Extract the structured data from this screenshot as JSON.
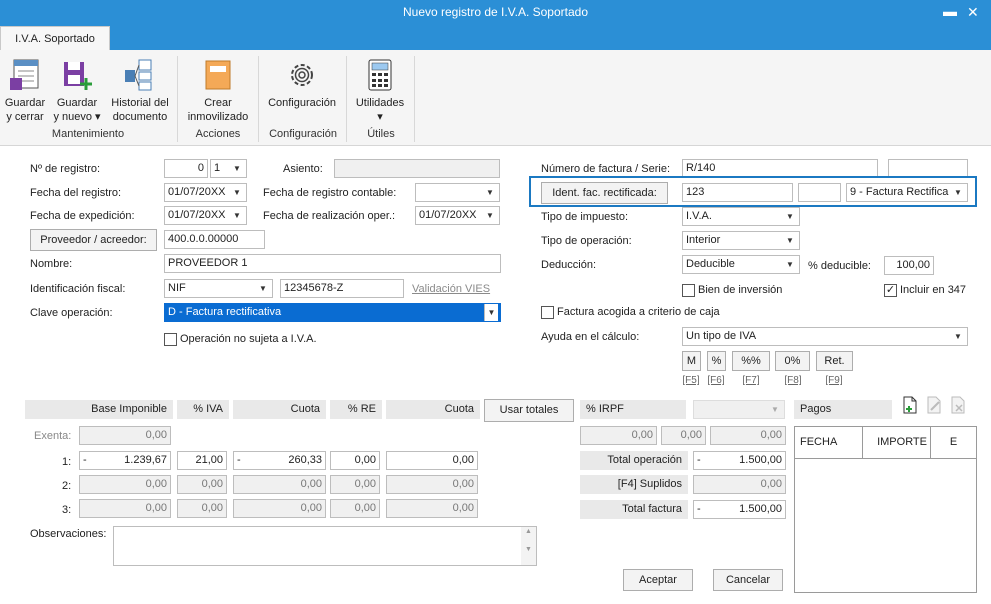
{
  "window": {
    "title": "Nuevo registro de I.V.A. Soportado",
    "minimize": "▬",
    "close": "✕"
  },
  "tab": {
    "label": "I.V.A. Soportado"
  },
  "ribbon": {
    "guardar_cerrar": "Guardar\ny cerrar",
    "guardar_nuevo": "Guardar\ny nuevo ▾",
    "historial": "Historial del\ndocumento",
    "crear": "Crear\ninmovilizado",
    "configuracion": "Configuración",
    "utilidades": "Utilidades\n▾",
    "groups": {
      "mantenimiento": "Mantenimiento",
      "acciones": "Acciones",
      "configuracion": "Configuración",
      "utiles": "Útiles"
    }
  },
  "form": {
    "num_registro_label": "Nº de registro:",
    "num_registro_value": "0",
    "num_registro_serie": "1",
    "asiento_label": "Asiento:",
    "fecha_registro_label": "Fecha del registro:",
    "fecha_registro_value": "01/07/20XX",
    "fecha_contable_label": "Fecha de registro contable:",
    "fecha_expedicion_label": "Fecha de expedición:",
    "fecha_expedicion_value": "01/07/20XX",
    "fecha_realizacion_label": "Fecha de realización oper.:",
    "fecha_realizacion_value": "01/07/20XX",
    "proveedor_button": "Proveedor / acreedor:",
    "proveedor_value": "400.0.0.00000",
    "nombre_label": "Nombre:",
    "nombre_value": "PROVEEDOR 1",
    "ident_fiscal_label": "Identificación fiscal:",
    "ident_tipo": "NIF",
    "ident_value": "12345678-Z",
    "validacion_vies": "Validación VIES",
    "clave_label": "Clave operación:",
    "clave_value": "D - Factura rectificativa",
    "no_sujeta_label": "Operación no sujeta a I.V.A.",
    "num_factura_label": "Número de factura / Serie:",
    "num_factura_value": "R/140",
    "ident_rect_button": "Ident. fac. rectificada:",
    "ident_rect_value": "123",
    "ident_rect_tipo": "9 - Factura Rectifica",
    "tipo_impuesto_label": "Tipo de impuesto:",
    "tipo_impuesto_value": "I.V.A.",
    "tipo_operacion_label": "Tipo de operación:",
    "tipo_operacion_value": "Interior",
    "deduccion_label": "Deducción:",
    "deduccion_value": "Deducible",
    "pct_deducible_label": "% deducible:",
    "pct_deducible_value": "100,00",
    "bien_inversion_label": "Bien de inversión",
    "incluir_347_label": "Incluir en 347",
    "criterio_caja_label": "Factura acogida a criterio de caja",
    "ayuda_label": "Ayuda en el cálculo:",
    "ayuda_value": "Un tipo de IVA",
    "calc_buttons": [
      {
        "label": "M",
        "key": "[F5]"
      },
      {
        "label": "%",
        "key": "[F6]"
      },
      {
        "label": "%%",
        "key": "[F7]"
      },
      {
        "label": "0%",
        "key": "[F8]"
      },
      {
        "label": "Ret.",
        "key": "[F9]"
      }
    ]
  },
  "grid": {
    "headers": {
      "base": "Base Imponible",
      "iva": "% IVA",
      "cuota": "Cuota",
      "re": "% RE",
      "cuota_re": "Cuota",
      "irpf": "% IRPF",
      "pagos": "Pagos"
    },
    "usar_totales": "Usar totales",
    "exenta_label": "Exenta:",
    "exenta_value": "0,00",
    "rows": [
      {
        "n": "1:",
        "base_sign": "-",
        "base": "1.239,67",
        "iva": "21,00",
        "cuota_sign": "-",
        "cuota": "260,33",
        "re": "0,00",
        "cuota_re": "0,00"
      },
      {
        "n": "2:",
        "base_sign": "",
        "base": "0,00",
        "iva": "0,00",
        "cuota_sign": "",
        "cuota": "0,00",
        "re": "0,00",
        "cuota_re": "0,00"
      },
      {
        "n": "3:",
        "base_sign": "",
        "base": "0,00",
        "iva": "0,00",
        "cuota_sign": "",
        "cuota": "0,00",
        "re": "0,00",
        "cuota_re": "0,00"
      }
    ],
    "irpf_values": [
      "0,00",
      "0,00",
      "0,00"
    ],
    "total_operacion_label": "Total operación",
    "total_operacion_sign": "-",
    "total_operacion": "1.500,00",
    "suplidos_label": "[F4] Suplidos",
    "suplidos": "0,00",
    "total_factura_label": "Total factura",
    "total_factura_sign": "-",
    "total_factura": "1.500,00",
    "pagos_cols": [
      "FECHA",
      "IMPORTE",
      "E"
    ]
  },
  "observaciones_label": "Observaciones:",
  "aceptar": "Aceptar",
  "cancelar": "Cancelar"
}
